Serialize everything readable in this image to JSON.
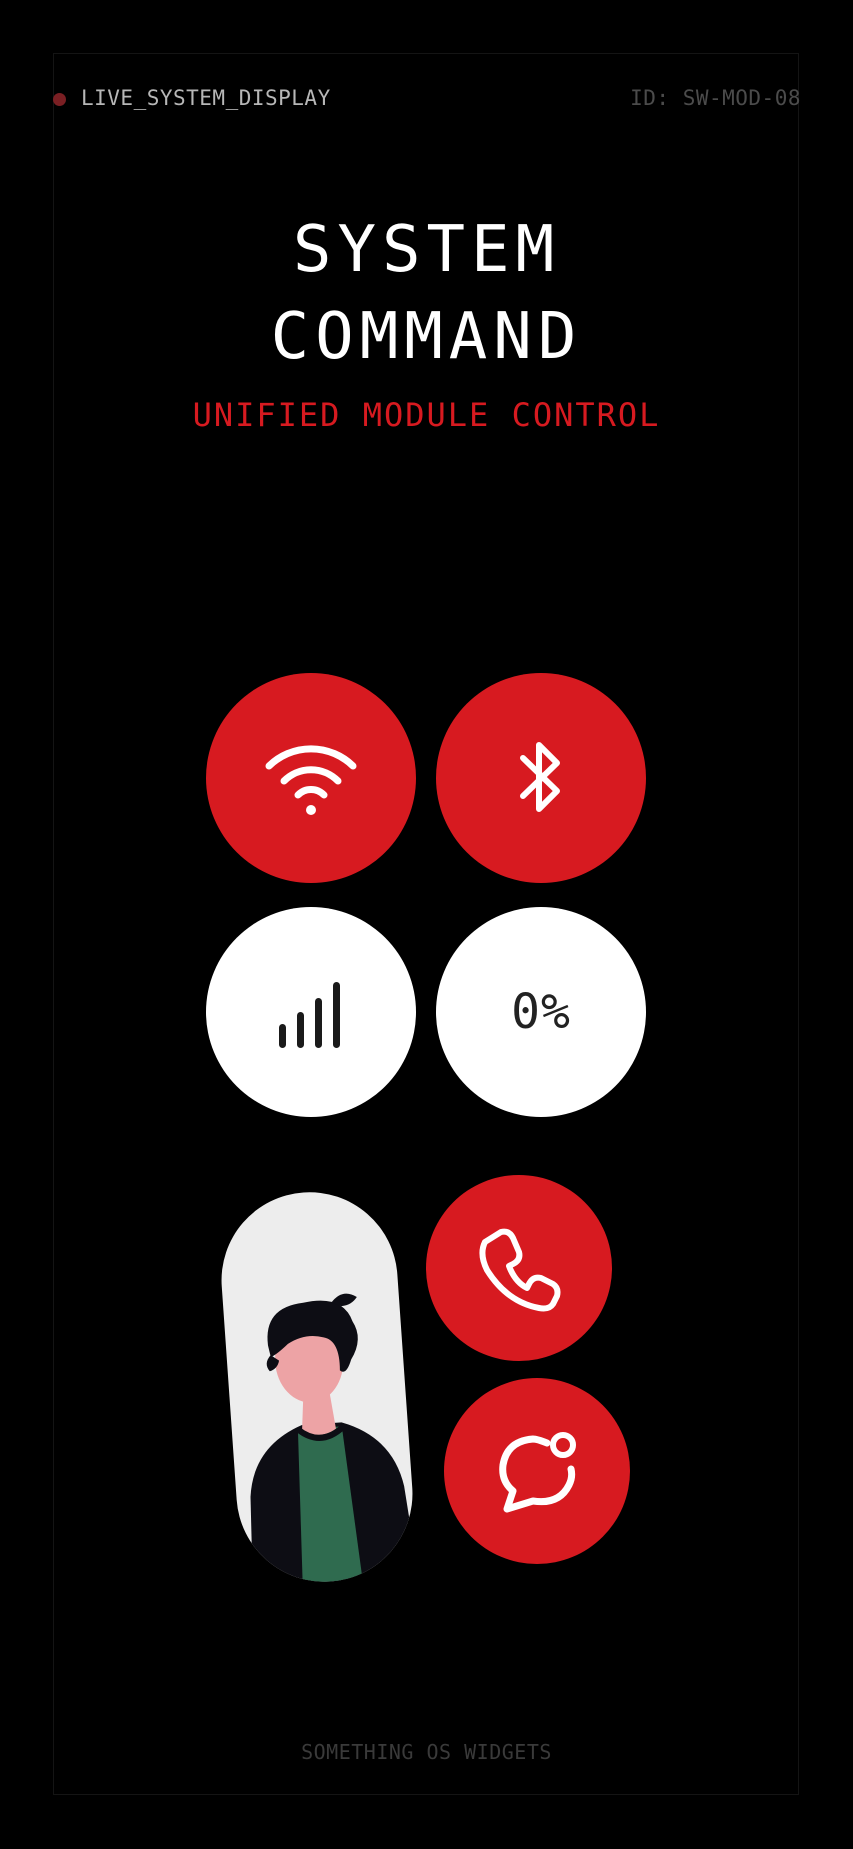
{
  "header": {
    "status_label": "LIVE_SYSTEM_DISPLAY",
    "system_id": "ID: SW-MOD-08"
  },
  "title": {
    "line1": "SYSTEM",
    "line2": "COMMAND",
    "subtitle": "UNIFIED MODULE CONTROL"
  },
  "tiles": {
    "wifi": {
      "icon": "wifi-icon",
      "state": "on",
      "color": "#d71a20"
    },
    "bluetooth": {
      "icon": "bluetooth-icon",
      "state": "on",
      "color": "#d71a20"
    },
    "signal": {
      "icon": "signal-bars-icon",
      "state": "off",
      "color": "#ffffff"
    },
    "battery": {
      "label": "0%",
      "state": "off",
      "color": "#ffffff"
    }
  },
  "contact": {
    "avatar": "person-avatar",
    "actions": [
      {
        "icon": "phone-icon"
      },
      {
        "icon": "message-icon"
      }
    ]
  },
  "footer": {
    "label": "SOMETHING OS WIDGETS"
  },
  "colors": {
    "accent": "#d71a20",
    "background": "#000000",
    "text": "#ffffff"
  }
}
